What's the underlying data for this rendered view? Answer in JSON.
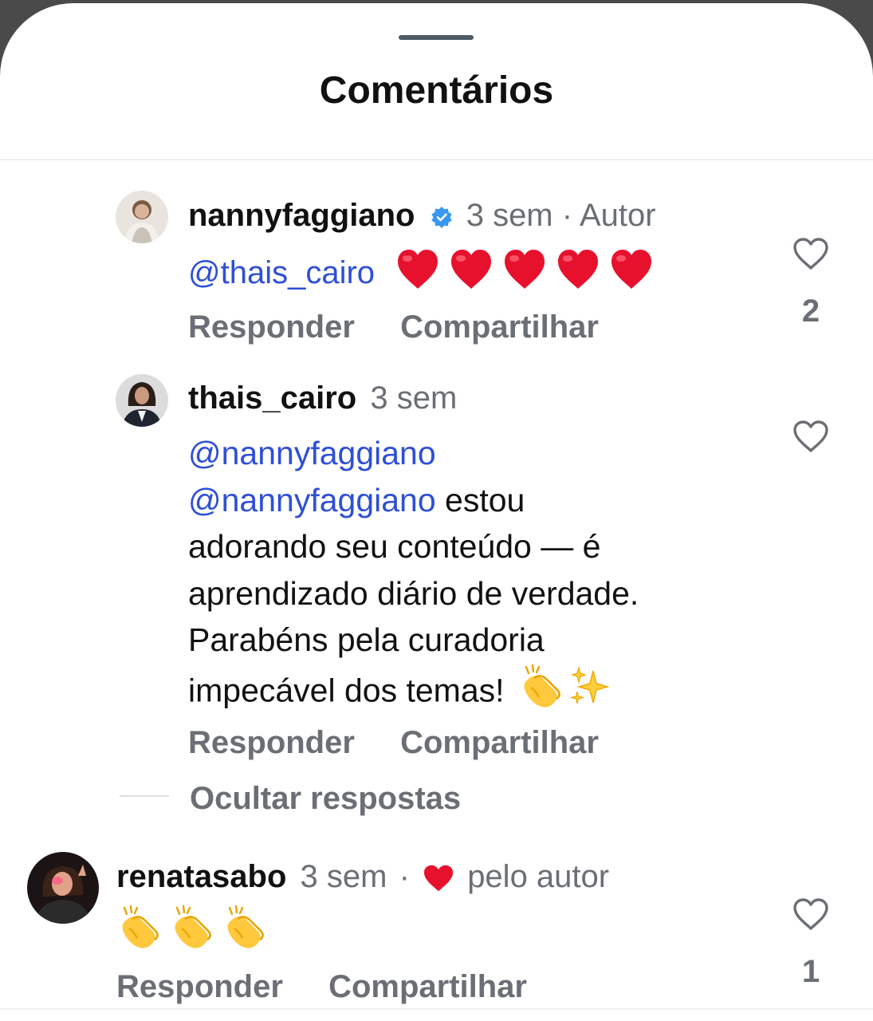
{
  "sheet": {
    "title": "Comentários"
  },
  "comments": [
    {
      "username": "nannyfaggiano",
      "verified": true,
      "time": "3 sem",
      "tag": "· Autor",
      "mention": "@thais_cairo",
      "emojis": [
        "heart",
        "heart",
        "heart",
        "heart",
        "heart"
      ],
      "reply_label": "Responder",
      "share_label": "Compartilhar",
      "likes": "2"
    },
    {
      "username": "thais_cairo",
      "time": "3 sem",
      "mention_1": "@nannyfaggiano",
      "mention_2": "@nannyfaggiano",
      "text_line_1": " estou",
      "text_line_2": "adorando seu conteúdo — é",
      "text_line_3": "aprendizado diário de verdade.",
      "text_line_4": "Parabéns pela curadoria",
      "text_line_5": "impecável dos temas! ",
      "emojis": [
        "clapping-hands",
        "sparkles"
      ],
      "reply_label": "Responder",
      "share_label": "Compartilhar",
      "likes": ""
    },
    {
      "username": "renatasabo",
      "time": "3 sem",
      "liked_by_author_prefix": "·",
      "liked_by_author_label": "pelo autor",
      "emojis": [
        "clapping-hands",
        "clapping-hands",
        "clapping-hands"
      ],
      "reply_label": "Responder",
      "share_label": "Compartilhar",
      "likes": "1"
    }
  ],
  "thread": {
    "hide_replies_label": "Ocultar respostas"
  },
  "colors": {
    "mention": "#2f4fd6",
    "meta": "#6b6f75",
    "verified": "#3897f0",
    "heart": "#e8112d"
  }
}
